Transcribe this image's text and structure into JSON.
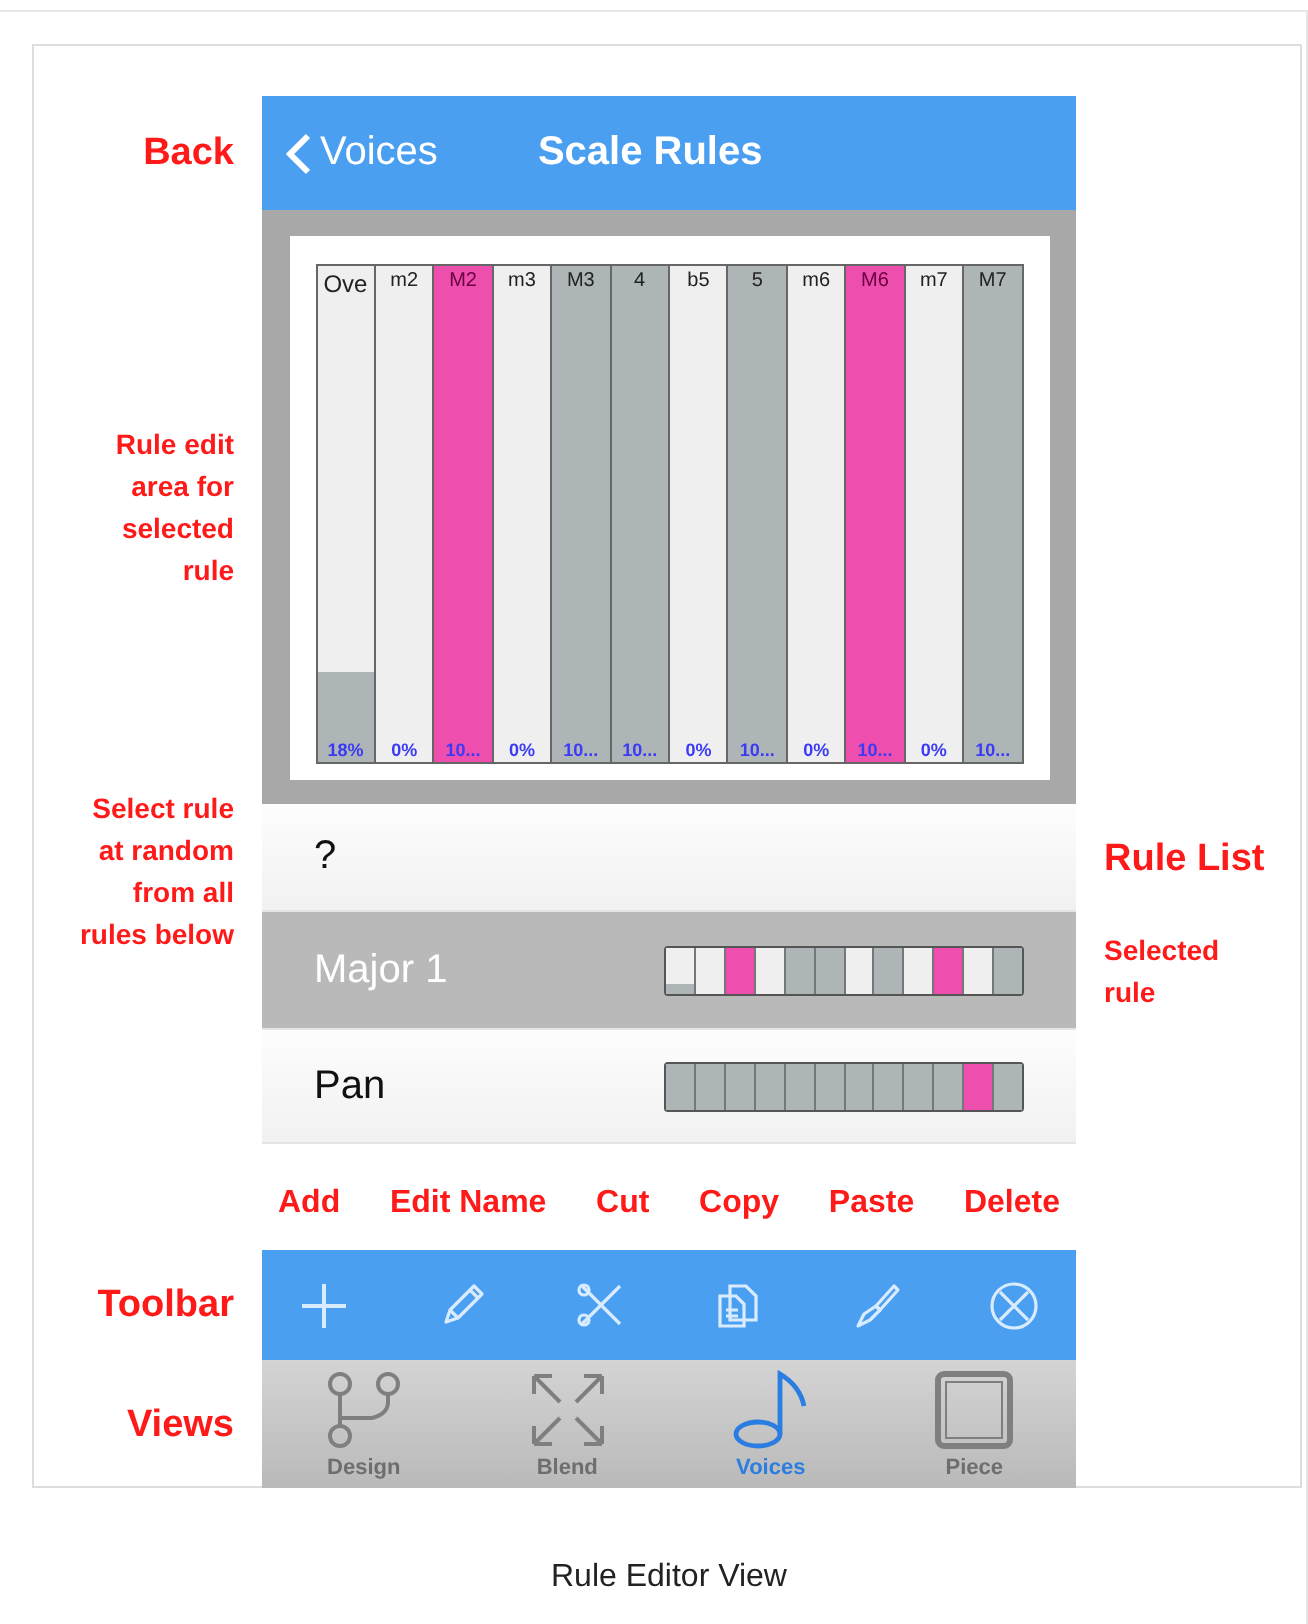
{
  "annotations": {
    "back": "Back",
    "edit_area": "Rule edit area for selected rule",
    "random": "Select rule at random from all rules below",
    "rule_list": "Rule List",
    "selected_rule": "Selected rule",
    "toolbar": "Toolbar",
    "views": "Views"
  },
  "nav": {
    "back_label": "Voices",
    "title": "Scale Rules"
  },
  "intervals": [
    {
      "label": "Ove",
      "reading": "18%",
      "level": 0.18,
      "highlighted": false
    },
    {
      "label": "m2",
      "reading": "0%",
      "level": 0,
      "highlighted": false
    },
    {
      "label": "M2",
      "reading": "10...",
      "level": 1,
      "highlighted": true
    },
    {
      "label": "m3",
      "reading": "0%",
      "level": 0,
      "highlighted": false
    },
    {
      "label": "M3",
      "reading": "10...",
      "level": 1,
      "highlighted": false
    },
    {
      "label": "4",
      "reading": "10...",
      "level": 1,
      "highlighted": false
    },
    {
      "label": "b5",
      "reading": "0%",
      "level": 0,
      "highlighted": false
    },
    {
      "label": "5",
      "reading": "10...",
      "level": 1,
      "highlighted": false
    },
    {
      "label": "m6",
      "reading": "0%",
      "level": 0,
      "highlighted": false
    },
    {
      "label": "M6",
      "reading": "10...",
      "level": 1,
      "highlighted": true
    },
    {
      "label": "m7",
      "reading": "0%",
      "level": 0,
      "highlighted": false
    },
    {
      "label": "M7",
      "reading": "10...",
      "level": 1,
      "highlighted": false
    }
  ],
  "rules": [
    {
      "name": "?",
      "selected": false
    },
    {
      "name": "Major 1",
      "selected": true,
      "cells": [
        {
          "level": 0.18,
          "highlighted": false
        },
        {
          "level": 0,
          "highlighted": false
        },
        {
          "level": 1,
          "highlighted": true
        },
        {
          "level": 0,
          "highlighted": false
        },
        {
          "level": 1,
          "highlighted": false
        },
        {
          "level": 1,
          "highlighted": false
        },
        {
          "level": 0,
          "highlighted": false
        },
        {
          "level": 1,
          "highlighted": false
        },
        {
          "level": 0,
          "highlighted": false
        },
        {
          "level": 1,
          "highlighted": true
        },
        {
          "level": 0,
          "highlighted": false
        },
        {
          "level": 1,
          "highlighted": false
        }
      ]
    },
    {
      "name": "Pan",
      "selected": false,
      "cells": [
        {
          "level": 1,
          "highlighted": false
        },
        {
          "level": 1,
          "highlighted": false
        },
        {
          "level": 1,
          "highlighted": false
        },
        {
          "level": 1,
          "highlighted": false
        },
        {
          "level": 1,
          "highlighted": false
        },
        {
          "level": 1,
          "highlighted": false
        },
        {
          "level": 1,
          "highlighted": false
        },
        {
          "level": 1,
          "highlighted": false
        },
        {
          "level": 1,
          "highlighted": false
        },
        {
          "level": 1,
          "highlighted": false
        },
        {
          "level": 1,
          "highlighted": true
        },
        {
          "level": 1,
          "highlighted": false
        }
      ]
    }
  ],
  "toolbar": [
    {
      "note": "Add"
    },
    {
      "note": "Edit Name"
    },
    {
      "note": "Cut"
    },
    {
      "note": "Copy"
    },
    {
      "note": "Paste"
    },
    {
      "note": "Delete"
    }
  ],
  "tabs": [
    {
      "label": "Design",
      "selected": false
    },
    {
      "label": "Blend",
      "selected": false
    },
    {
      "label": "Voices",
      "selected": true
    },
    {
      "label": "Piece",
      "selected": false
    }
  ],
  "caption": "Rule Editor View"
}
